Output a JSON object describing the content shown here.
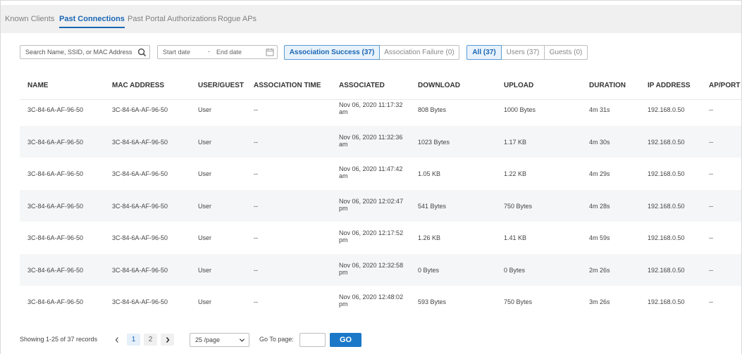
{
  "tabs": [
    {
      "label": "Known Clients",
      "active": false
    },
    {
      "label": "Past Connections",
      "active": true
    },
    {
      "label": "Past Portal Authorizations",
      "active": false
    },
    {
      "label": "Rogue APs",
      "active": false
    }
  ],
  "search": {
    "placeholder": "Search Name, SSID, or MAC Address",
    "icon": "search-icon"
  },
  "date_range": {
    "start_placeholder": "Start date",
    "separator": "-",
    "end_placeholder": "End date",
    "icon": "calendar-icon"
  },
  "association_filter": {
    "success_label": "Association Success (37)",
    "failure_label": "Association Failure (0)",
    "selected": "success"
  },
  "user_filter": {
    "all_label": "All (37)",
    "users_label": "Users (37)",
    "guests_label": "Guests (0)",
    "selected": "all"
  },
  "table": {
    "columns": [
      "NAME",
      "MAC ADDRESS",
      "USER/GUEST",
      "ASSOCIATION TIME",
      "ASSOCIATED",
      "DOWNLOAD",
      "UPLOAD",
      "DURATION",
      "IP ADDRESS",
      "AP/PORT"
    ],
    "rows": [
      [
        "3C-84-6A-AF-96-50",
        "3C-84-6A-AF-96-50",
        "User",
        "--",
        "Nov 06, 2020 11:17:32 am",
        "808 Bytes",
        "1000 Bytes",
        "4m 31s",
        "192.168.0.50",
        "--"
      ],
      [
        "3C-84-6A-AF-96-50",
        "3C-84-6A-AF-96-50",
        "User",
        "--",
        "Nov 06, 2020 11:32:36 am",
        "1023 Bytes",
        "1.17 KB",
        "4m 30s",
        "192.168.0.50",
        "--"
      ],
      [
        "3C-84-6A-AF-96-50",
        "3C-84-6A-AF-96-50",
        "User",
        "--",
        "Nov 06, 2020 11:47:42 am",
        "1.05 KB",
        "1.22 KB",
        "4m 29s",
        "192.168.0.50",
        "--"
      ],
      [
        "3C-84-6A-AF-96-50",
        "3C-84-6A-AF-96-50",
        "User",
        "--",
        "Nov 06, 2020 12:02:47 pm",
        "541 Bytes",
        "750 Bytes",
        "4m 28s",
        "192.168.0.50",
        "--"
      ],
      [
        "3C-84-6A-AF-96-50",
        "3C-84-6A-AF-96-50",
        "User",
        "--",
        "Nov 06, 2020 12:17:52 pm",
        "1.26 KB",
        "1.41 KB",
        "4m 59s",
        "192.168.0.50",
        "--"
      ],
      [
        "3C-84-6A-AF-96-50",
        "3C-84-6A-AF-96-50",
        "User",
        "--",
        "Nov 06, 2020 12:32:58 pm",
        "0 Bytes",
        "0 Bytes",
        "2m 26s",
        "192.168.0.50",
        "--"
      ],
      [
        "3C-84-6A-AF-96-50",
        "3C-84-6A-AF-96-50",
        "User",
        "--",
        "Nov 06, 2020 12:48:02 pm",
        "593 Bytes",
        "750 Bytes",
        "3m 26s",
        "192.168.0.50",
        "--"
      ]
    ]
  },
  "pagination": {
    "showing": "Showing 1-25 of 37 records",
    "pages": [
      "1",
      "2"
    ],
    "current_page": "1",
    "prev_icon": "chevron-left-icon",
    "next_icon": "chevron-right-icon",
    "per_page": "25 /page",
    "goto_label": "Go To page:",
    "goto_value": "",
    "go_button": "GO"
  },
  "colors": {
    "accent": "#1a66b4",
    "go_button": "#1b78c8",
    "row_stripe": "#f5f6f7",
    "tab_bar": "#f0f0f0"
  }
}
